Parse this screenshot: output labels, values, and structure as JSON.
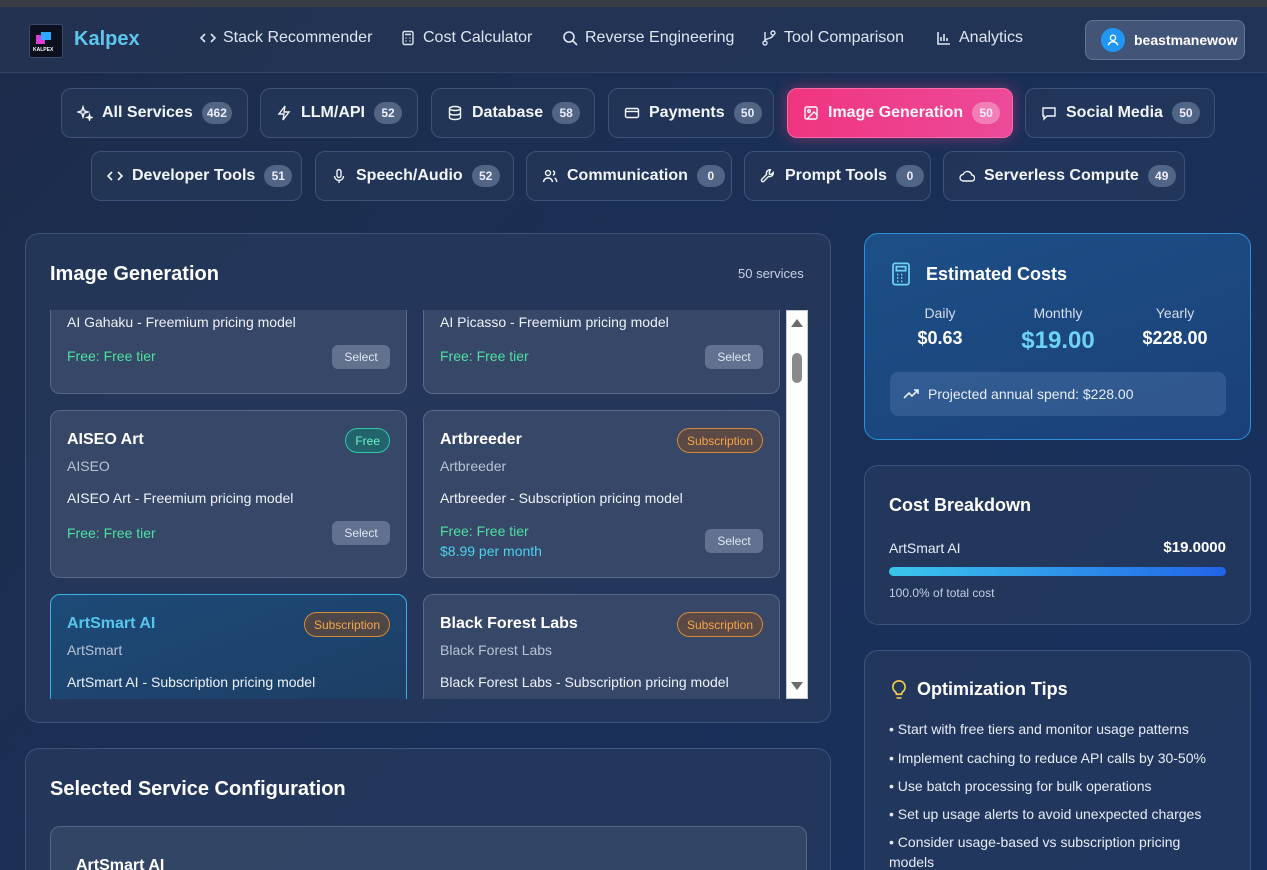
{
  "app": {
    "brand": "Kalpex",
    "logo_text": "KALPEX"
  },
  "nav": {
    "links": [
      {
        "label": "Stack Recommender",
        "icon": "code-icon"
      },
      {
        "label": "Cost Calculator",
        "icon": "calculator-icon"
      },
      {
        "label": "Reverse Engineering",
        "icon": "search-icon"
      },
      {
        "label": "Tool Comparison",
        "icon": "git-branch-icon"
      },
      {
        "label": "Analytics",
        "icon": "bar-chart-icon"
      }
    ],
    "user": "beastmanewow"
  },
  "categories": [
    {
      "label": "All Services",
      "count": "462",
      "icon": "sparkles-icon"
    },
    {
      "label": "LLM/API",
      "count": "52",
      "icon": "zap-icon"
    },
    {
      "label": "Database",
      "count": "58",
      "icon": "database-icon"
    },
    {
      "label": "Payments",
      "count": "50",
      "icon": "credit-card-icon"
    },
    {
      "label": "Image Generation",
      "count": "50",
      "icon": "image-icon",
      "active": true
    },
    {
      "label": "Social Media",
      "count": "50",
      "icon": "message-icon"
    },
    {
      "label": "Developer Tools",
      "count": "51",
      "icon": "code-icon"
    },
    {
      "label": "Speech/Audio",
      "count": "52",
      "icon": "microphone-icon"
    },
    {
      "label": "Communication",
      "count": "0",
      "icon": "users-icon"
    },
    {
      "label": "Prompt Tools",
      "count": "0",
      "icon": "wrench-icon"
    },
    {
      "label": "Serverless Compute",
      "count": "49",
      "icon": "cloud-icon"
    }
  ],
  "services": {
    "title": "Image Generation",
    "count_label": "50 services",
    "select_label": "Select",
    "cards": [
      {
        "desc": "AI Gahaku - Freemium pricing model",
        "free": "Free: Free tier"
      },
      {
        "desc": "AI Picasso - Freemium pricing model",
        "free": "Free: Free tier"
      },
      {
        "name": "AISEO Art",
        "provider": "AISEO",
        "badge": "Free",
        "desc": "AISEO Art - Freemium pricing model",
        "free": "Free: Free tier"
      },
      {
        "name": "Artbreeder",
        "provider": "Artbreeder",
        "badge": "Subscription",
        "desc": "Artbreeder - Subscription pricing model",
        "free": "Free: Free tier",
        "price": "$8.99 per month"
      },
      {
        "name": "ArtSmart AI",
        "provider": "ArtSmart",
        "badge": "Subscription",
        "desc": "ArtSmart AI - Subscription pricing model",
        "selected": true
      },
      {
        "name": "Black Forest Labs",
        "provider": "Black Forest Labs",
        "badge": "Subscription",
        "desc": "Black Forest Labs - Subscription pricing model"
      }
    ]
  },
  "config": {
    "title": "Selected Service Configuration",
    "service_name": "ArtSmart AI"
  },
  "estimate": {
    "title": "Estimated Costs",
    "daily_label": "Daily",
    "daily": "$0.63",
    "monthly_label": "Monthly",
    "monthly": "$19.00",
    "yearly_label": "Yearly",
    "yearly": "$228.00",
    "projected": "Projected annual spend: $228.00"
  },
  "breakdown": {
    "title": "Cost Breakdown",
    "item": "ArtSmart AI",
    "amount": "$19.0000",
    "percent_label": "100.0% of total cost",
    "fraction": 1.0
  },
  "tips": {
    "title": "Optimization Tips",
    "items": [
      "• Start with free tiers and monitor usage patterns",
      "• Implement caching to reduce API calls by 30-50%",
      "• Use batch processing for bulk operations",
      "• Set up usage alerts to avoid unexpected charges",
      "• Consider usage-based vs subscription pricing models"
    ]
  },
  "colors": {
    "accent": "#ec4a9a",
    "brand": "#5ec6ee",
    "free": "#4ee0a0",
    "subscription": "#f6a54a"
  }
}
